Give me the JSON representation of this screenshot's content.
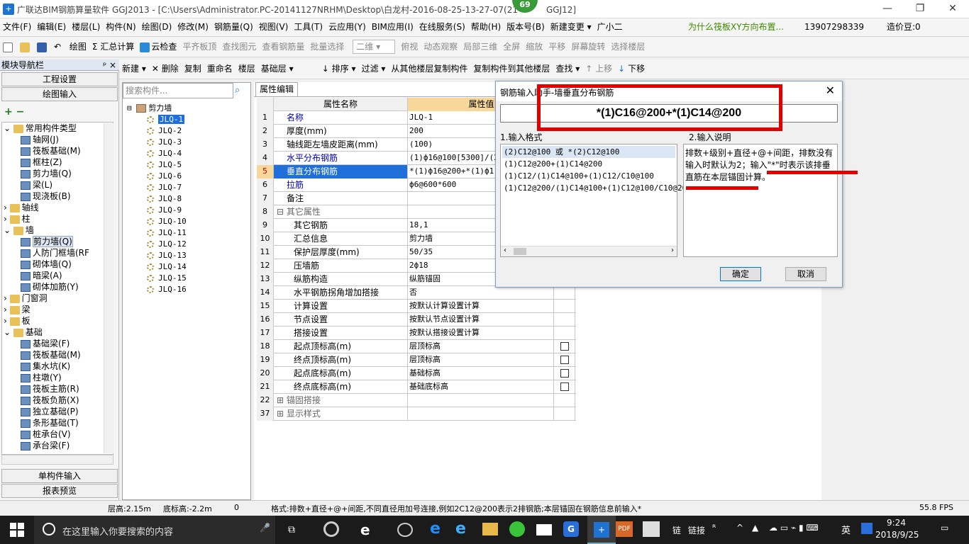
{
  "window": {
    "title": "广联达BIM钢筋算量软件 GGJ2013 - [C:\\Users\\Administrator.PC-20141127NRHM\\Desktop\\白龙村-2016-08-25-13-27-07(21",
    "title_suffix": "GGJ12]",
    "badge": "69",
    "minimize": "—",
    "restore": "❐",
    "close": "✕"
  },
  "menu": [
    "文件(F)",
    "编辑(E)",
    "楼层(L)",
    "构件(N)",
    "绘图(D)",
    "修改(M)",
    "钢筋量(Q)",
    "视图(V)",
    "工具(T)",
    "云应用(Y)",
    "BIM应用(I)",
    "在线服务(S)",
    "帮助(H)",
    "版本号(B)",
    "新建变更 ▾",
    "广小二"
  ],
  "menu_right": {
    "question": "为什么筏板XY方向布置...",
    "phone": "13907298339",
    "beans": "造价豆:0"
  },
  "toolbar1": [
    "绘图",
    "汇总计算",
    "云检查",
    "平齐板顶",
    "查找图元",
    "查看钢筋量",
    "批量选择",
    "二维",
    "俯视",
    "动态观察",
    "局部三维",
    "全屏",
    "缩放",
    "平移",
    "屏幕旋转",
    "选择楼层"
  ],
  "toolbar2": [
    "新建",
    "删除",
    "复制",
    "重命名",
    "楼层",
    "基础层",
    "排序",
    "过滤",
    "从其他楼层复制构件",
    "复制构件到其他楼层",
    "查找",
    "上移",
    "下移"
  ],
  "nav": {
    "header": "模块导航栏",
    "pin": "ᵖ ×",
    "project_settings": "工程设置",
    "drawing_input": "绘图输入",
    "single_input": "单构件输入",
    "report_preview": "报表预览",
    "tree": [
      {
        "label": "常用构件类型",
        "level": 0,
        "type": "folder",
        "expanded": true
      },
      {
        "label": "轴网(J)",
        "level": 1,
        "type": "item"
      },
      {
        "label": "筏板基础(M)",
        "level": 1,
        "type": "item"
      },
      {
        "label": "框柱(Z)",
        "level": 1,
        "type": "item"
      },
      {
        "label": "剪力墙(Q)",
        "level": 1,
        "type": "item"
      },
      {
        "label": "梁(L)",
        "level": 1,
        "type": "item"
      },
      {
        "label": "现浇板(B)",
        "level": 1,
        "type": "item"
      },
      {
        "label": "轴线",
        "level": 0,
        "type": "folder",
        "expanded": false
      },
      {
        "label": "柱",
        "level": 0,
        "type": "folder",
        "expanded": false
      },
      {
        "label": "墙",
        "level": 0,
        "type": "folder",
        "expanded": true
      },
      {
        "label": "剪力墙(Q)",
        "level": 1,
        "type": "item",
        "selected": true
      },
      {
        "label": "人防门框墙(RF",
        "level": 1,
        "type": "item"
      },
      {
        "label": "砌体墙(Q)",
        "level": 1,
        "type": "item"
      },
      {
        "label": "暗梁(A)",
        "level": 1,
        "type": "item"
      },
      {
        "label": "砌体加筋(Y)",
        "level": 1,
        "type": "item"
      },
      {
        "label": "门窗洞",
        "level": 0,
        "type": "folder",
        "expanded": false
      },
      {
        "label": "梁",
        "level": 0,
        "type": "folder",
        "expanded": false
      },
      {
        "label": "板",
        "level": 0,
        "type": "folder",
        "expanded": false
      },
      {
        "label": "基础",
        "level": 0,
        "type": "folder",
        "expanded": true
      },
      {
        "label": "基础梁(F)",
        "level": 1,
        "type": "item"
      },
      {
        "label": "筏板基础(M)",
        "level": 1,
        "type": "item"
      },
      {
        "label": "集水坑(K)",
        "level": 1,
        "type": "item"
      },
      {
        "label": "柱墩(Y)",
        "level": 1,
        "type": "item"
      },
      {
        "label": "筏板主筋(R)",
        "level": 1,
        "type": "item"
      },
      {
        "label": "筏板负筋(X)",
        "level": 1,
        "type": "item"
      },
      {
        "label": "独立基础(P)",
        "level": 1,
        "type": "item"
      },
      {
        "label": "条形基础(T)",
        "level": 1,
        "type": "item"
      },
      {
        "label": "桩承台(V)",
        "level": 1,
        "type": "item"
      },
      {
        "label": "承台梁(F)",
        "level": 1,
        "type": "item"
      }
    ]
  },
  "components": {
    "search_placeholder": "搜索构件...",
    "root": "剪力墙",
    "items": [
      "JLQ-1",
      "JLQ-2",
      "JLQ-3",
      "JLQ-4",
      "JLQ-5",
      "JLQ-6",
      "JLQ-7",
      "JLQ-8",
      "JLQ-9",
      "JLQ-10",
      "JLQ-11",
      "JLQ-12",
      "JLQ-13",
      "JLQ-14",
      "JLQ-15",
      "JLQ-16"
    ]
  },
  "props": {
    "tab": "属性编辑",
    "col_name": "属性名称",
    "col_value": "属性值",
    "rows": [
      {
        "n": "1",
        "name": "名称",
        "value": "JLQ-1",
        "blue": true
      },
      {
        "n": "2",
        "name": "厚度(mm)",
        "value": "200"
      },
      {
        "n": "3",
        "name": "轴线距左墙皮距离(mm)",
        "value": "(100)"
      },
      {
        "n": "4",
        "name": "水平分布钢筋",
        "value": "(1)ф16@100[5300]/(2",
        "blue": true
      },
      {
        "n": "5",
        "name": "垂直分布钢筋",
        "value": "*(1)ф16@200+*(1)ф1",
        "blue": true,
        "selected": true
      },
      {
        "n": "6",
        "name": "拉筋",
        "value": "ф6@600*600",
        "blue": true
      },
      {
        "n": "7",
        "name": "备注",
        "value": ""
      },
      {
        "n": "8",
        "name": "其它属性",
        "value": "",
        "group": true
      },
      {
        "n": "9",
        "name": "其它钢筋",
        "value": "18,1",
        "indent": true
      },
      {
        "n": "10",
        "name": "汇总信息",
        "value": "剪力墙",
        "indent": true
      },
      {
        "n": "11",
        "name": "保护层厚度(mm)",
        "value": "50/35",
        "indent": true
      },
      {
        "n": "12",
        "name": "压墙筋",
        "value": "2ф18",
        "indent": true
      },
      {
        "n": "13",
        "name": "纵筋构造",
        "value": "纵筋锚固",
        "indent": true
      },
      {
        "n": "14",
        "name": "水平钢筋拐角增加搭接",
        "value": "否",
        "indent": true
      },
      {
        "n": "15",
        "name": "计算设置",
        "value": "按默认计算设置计算",
        "indent": true
      },
      {
        "n": "16",
        "name": "节点设置",
        "value": "按默认节点设置计算",
        "indent": true
      },
      {
        "n": "17",
        "name": "搭接设置",
        "value": "按默认搭接设置计算",
        "indent": true
      },
      {
        "n": "18",
        "name": "起点顶标高(m)",
        "value": "层顶标高",
        "indent": true,
        "check": true
      },
      {
        "n": "19",
        "name": "终点顶标高(m)",
        "value": "层顶标高",
        "indent": true,
        "check": true
      },
      {
        "n": "20",
        "name": "起点底标高(m)",
        "value": "基础标高",
        "indent": true,
        "check": true
      },
      {
        "n": "21",
        "name": "终点底标高(m)",
        "value": "基础底标高",
        "indent": true,
        "check": true
      },
      {
        "n": "22",
        "name": "锚固搭接",
        "value": "",
        "group": true
      },
      {
        "n": "37",
        "name": "显示样式",
        "value": "",
        "group": true
      }
    ]
  },
  "dialog": {
    "title": "钢筋输入助手-墙垂直分布钢筋",
    "input": "*(1)C16@200+*(1)C14@200",
    "fmt_label": "1.输入格式",
    "desc_label": "2.输入说明",
    "formats": [
      "(2)C12@100 或 *(2)C12@100",
      "(1)C12@200+(1)C14@200",
      "(1)C12/(1)C14@100+(1)C12/C10@100",
      "(1)C12@200/(1)C14@100+(1)C12@100/C10@200"
    ],
    "description": "排数+级别+直径+@+间距，排数没有输入时默认为2；输入\"*\"时表示该排垂直筋在本层锚固计算。",
    "ok": "确定",
    "cancel": "取消",
    "accent": "#e00000"
  },
  "status": {
    "floor_height": "层高:2.15m",
    "bottom_height": "底标高:-2.2m",
    "zero": "0",
    "hint": "格式:排数+直径+@+间距,不同直径用加号连接,例如2C12@200表示2排钢筋;本层锚固在钢筋信息前输入*",
    "fps": "55.8 FPS"
  },
  "taskbar": {
    "search_placeholder": "在这里输入你要搜索的内容",
    "tray_text1": "链",
    "tray_text2": "链接",
    "ime": "英",
    "time": "9:24",
    "date": "2018/9/25"
  }
}
